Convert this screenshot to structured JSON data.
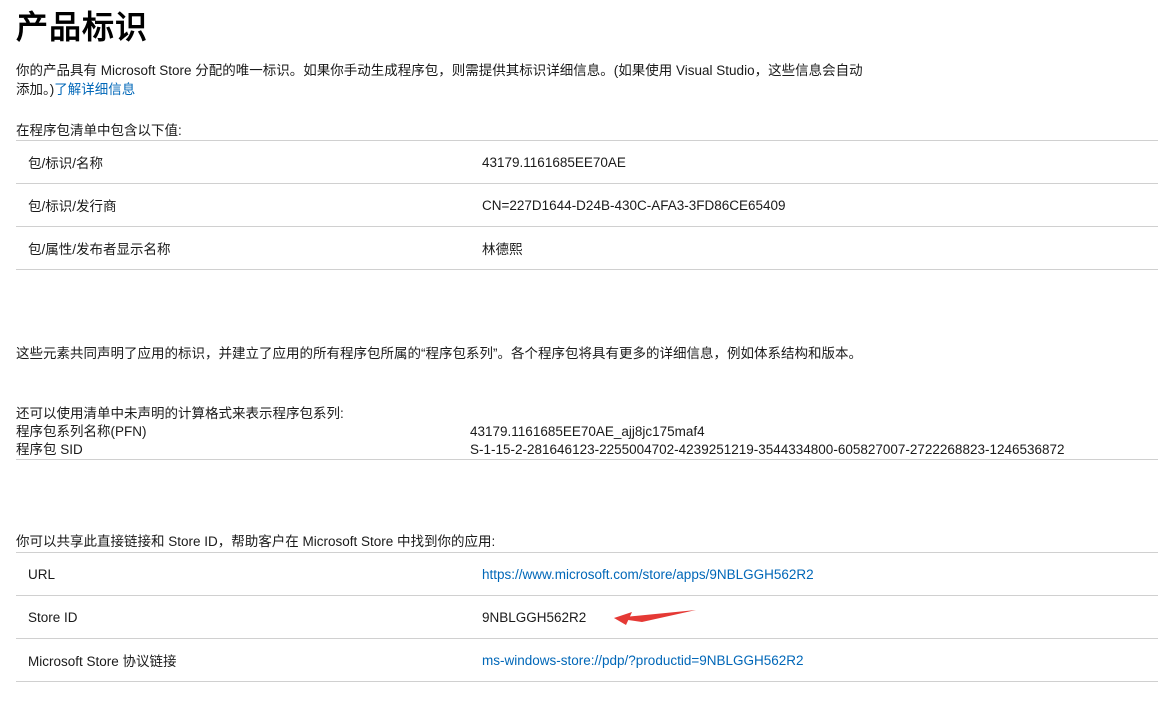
{
  "title": "产品标识",
  "intro": {
    "text": "你的产品具有 Microsoft Store 分配的唯一标识。如果你手动生成程序包，则需提供其标识详细信息。(如果使用 Visual Studio，这些信息会自动添加。)",
    "link": "了解详细信息"
  },
  "manifest": {
    "label": "在程序包清单中包含以下值:",
    "rows": [
      {
        "key": "包/标识/名称",
        "value": "43179.1161685EE70AE"
      },
      {
        "key": "包/标识/发行商",
        "value": "CN=227D1644-D24B-430C-AFA3-3FD86CE65409"
      },
      {
        "key": "包/属性/发布者显示名称",
        "value": "林德熙"
      }
    ]
  },
  "family_para": "这些元素共同声明了应用的标识，并建立了应用的所有程序包所属的“程序包系列”。各个程序包将具有更多的详细信息，例如体系结构和版本。",
  "computed": {
    "label": "还可以使用清单中未声明的计算格式来表示程序包系列:",
    "rows": [
      {
        "key": "程序包系列名称(PFN)",
        "value": "43179.1161685EE70AE_ajj8jc175maf4"
      },
      {
        "key": "程序包 SID",
        "value": "S-1-15-2-281646123-2255004702-4239251219-3544334800-605827007-2722268823-1246536872"
      }
    ]
  },
  "share": {
    "label": "你可以共享此直接链接和 Store ID，帮助客户在 Microsoft Store 中找到你的应用:",
    "rows": [
      {
        "key": "URL",
        "value": "https://www.microsoft.com/store/apps/9NBLGGH562R2"
      },
      {
        "key": "Store ID",
        "value": "9NBLGGH562R2"
      },
      {
        "key": "Microsoft Store 协议链接",
        "value": "ms-windows-store://pdp/?productid=9NBLGGH562R2"
      }
    ]
  },
  "colors": {
    "link": "#0067b8",
    "annotation_arrow": "#e53935",
    "divider": "#d0d0d0"
  }
}
